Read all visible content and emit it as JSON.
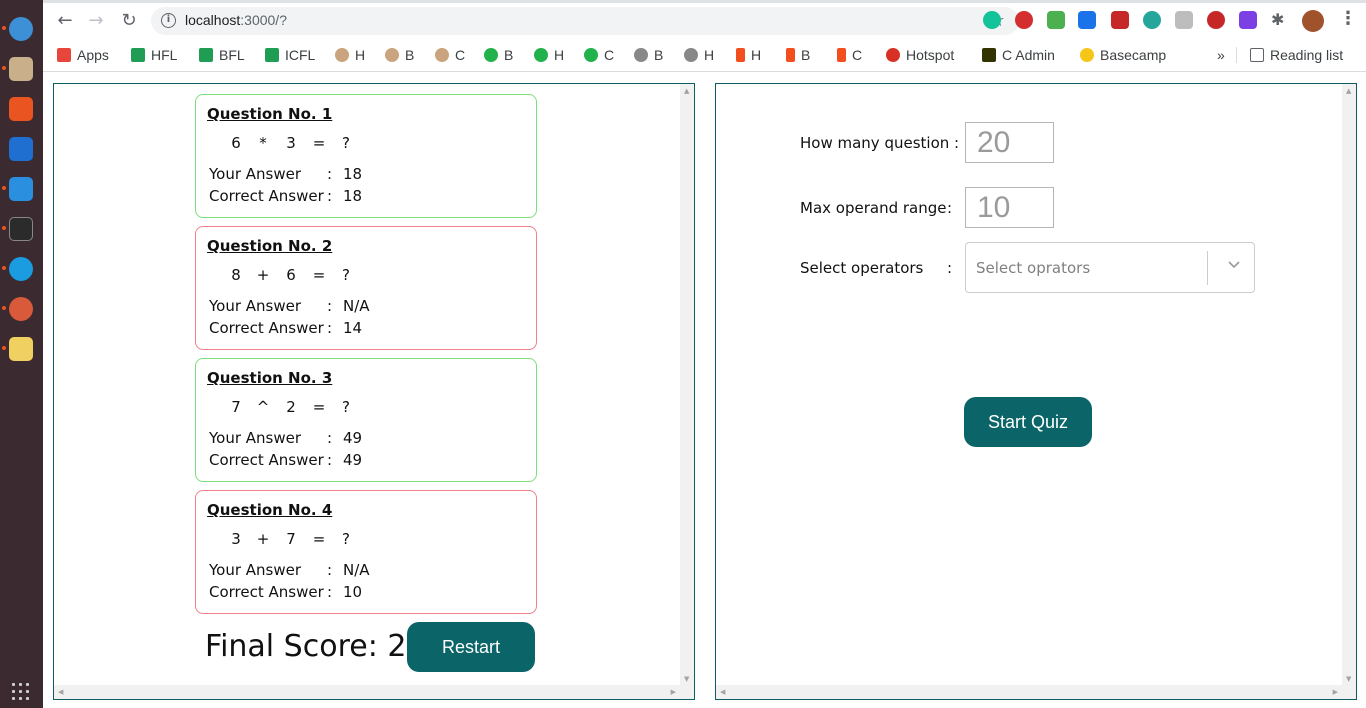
{
  "browser": {
    "url_host": "localhost",
    "url_path": ":3000/?",
    "bookmarks": [
      {
        "label": "Apps",
        "color": "#e8453c"
      },
      {
        "label": "HFL",
        "color": "#1f9d55"
      },
      {
        "label": "BFL",
        "color": "#1f9d55"
      },
      {
        "label": "ICFL",
        "color": "#1f9d55"
      },
      {
        "label": "H",
        "color": "#c9a47e"
      },
      {
        "label": "B",
        "color": "#c9a47e"
      },
      {
        "label": "C",
        "color": "#c9a47e"
      },
      {
        "label": "B",
        "color": "#22b24c"
      },
      {
        "label": "H",
        "color": "#22b24c"
      },
      {
        "label": "C",
        "color": "#22b24c"
      },
      {
        "label": "B",
        "color": "#888888"
      },
      {
        "label": "H",
        "color": "#888888"
      },
      {
        "label": "H",
        "color": "#f24e1e"
      },
      {
        "label": "B",
        "color": "#f24e1e"
      },
      {
        "label": "C",
        "color": "#f24e1e"
      },
      {
        "label": "Hotspot",
        "color": "#d93025"
      },
      {
        "label": "C Admin",
        "color": "#333300"
      },
      {
        "label": "Basecamp",
        "color": "#f5c518"
      }
    ],
    "overflow_label": "»",
    "reading_list_label": "Reading list"
  },
  "quiz": {
    "questions": [
      {
        "title": "Question No. 1",
        "a": "6",
        "op": "*",
        "b": "3",
        "eq": "=",
        "q": "?",
        "your_label": "Your Answer",
        "correct_label": "Correct Answer",
        "colon": ":",
        "your": "18",
        "correct": "18",
        "status": "correct"
      },
      {
        "title": "Question No. 2",
        "a": "8",
        "op": "+",
        "b": "6",
        "eq": "=",
        "q": "?",
        "your_label": "Your Answer",
        "correct_label": "Correct Answer",
        "colon": ":",
        "your": "N/A",
        "correct": "14",
        "status": "wrong"
      },
      {
        "title": "Question No. 3",
        "a": "7",
        "op": "^",
        "b": "2",
        "eq": "=",
        "q": "?",
        "your_label": "Your Answer",
        "correct_label": "Correct Answer",
        "colon": ":",
        "your": "49",
        "correct": "49",
        "status": "correct"
      },
      {
        "title": "Question No. 4",
        "a": "3",
        "op": "+",
        "b": "7",
        "eq": "=",
        "q": "?",
        "your_label": "Your Answer",
        "correct_label": "Correct Answer",
        "colon": ":",
        "your": "N/A",
        "correct": "10",
        "status": "wrong"
      }
    ],
    "final_score": "Final Score: 2",
    "restart_label": "Restart"
  },
  "form": {
    "count_label": "How many question :",
    "count_value": "20",
    "range_label": "Max operand range",
    "range_value": "10",
    "operators_label": "Select operators",
    "operators_placeholder": "Select oprators",
    "colon": ":",
    "start_label": "Start Quiz"
  },
  "colors": {
    "accent": "#0b6568",
    "correct_border": "#7be07b",
    "wrong_border": "#f0808a"
  }
}
